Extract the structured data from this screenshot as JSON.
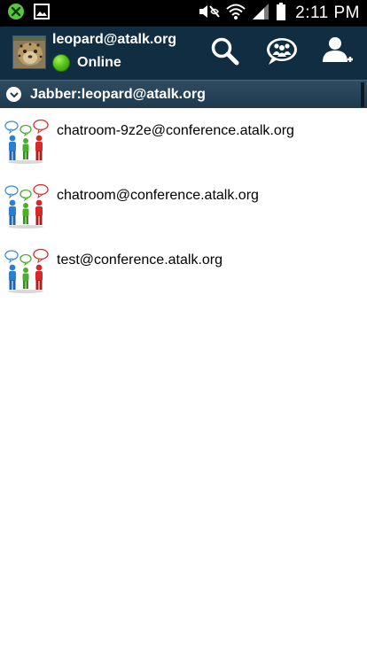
{
  "status_bar": {
    "time": "2:11 PM",
    "left_icons": [
      "notification-app-icon",
      "gallery-icon"
    ],
    "right_icons": [
      "mute-icon",
      "wifi-icon",
      "signal-icon",
      "battery-icon"
    ]
  },
  "header": {
    "account_name": "leopard@atalk.org",
    "presence": "Online",
    "actions": [
      "search-icon",
      "chatroom-icon",
      "add-contact-icon"
    ],
    "colors": {
      "background": "#102d42",
      "presence_online": "#57c51d"
    }
  },
  "account_group": {
    "label": "Jabber:leopard@atalk.org",
    "expanded": true
  },
  "chatrooms": [
    {
      "name": "chatroom-9z2e@conference.atalk.org"
    },
    {
      "name": "chatroom@conference.atalk.org"
    },
    {
      "name": "test@conference.atalk.org"
    }
  ]
}
